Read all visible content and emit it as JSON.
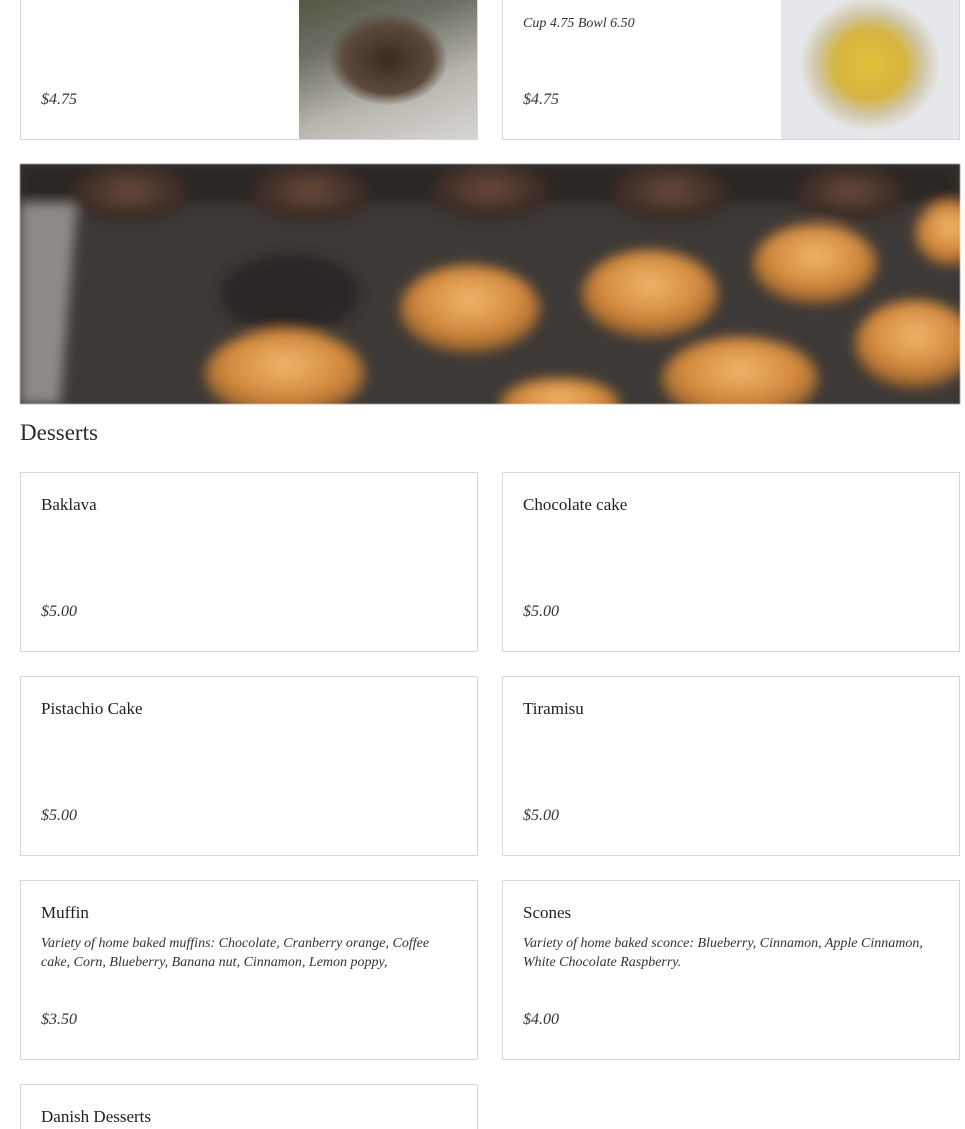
{
  "top_items": [
    {
      "name": "",
      "description": "",
      "price": "$4.75"
    },
    {
      "name": "",
      "description": "Cup 4.75 Bowl 6.50",
      "price": "$4.75"
    }
  ],
  "desserts": {
    "title": "Desserts",
    "items": [
      {
        "name": "Baklava",
        "description": "",
        "price": "$5.00"
      },
      {
        "name": "Chocolate cake",
        "description": "",
        "price": "$5.00"
      },
      {
        "name": "Pistachio Cake",
        "description": "",
        "price": "$5.00"
      },
      {
        "name": "Tiramisu",
        "description": "",
        "price": "$5.00"
      },
      {
        "name": "Muffin",
        "description": "Variety of home baked muffins: Chocolate, Cranberry orange, Coffee cake, Corn, Blueberry, Banana nut, Cinnamon, Lemon poppy,",
        "price": "$3.50"
      },
      {
        "name": "Scones",
        "description": "Variety of home baked sconce: Blueberry, Cinnamon, Apple Cinnamon, White Chocolate Raspberry.",
        "price": "$4.00"
      },
      {
        "name": "Danish Desserts",
        "description": "",
        "price": ""
      }
    ]
  }
}
